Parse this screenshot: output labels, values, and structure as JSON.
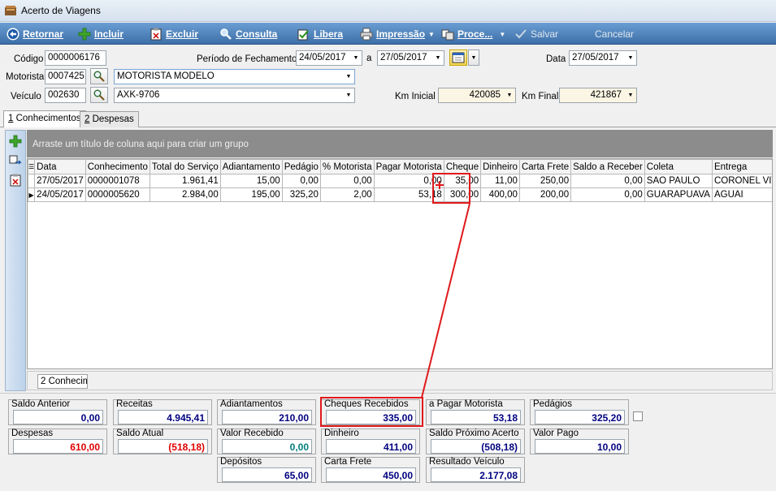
{
  "window": {
    "title": "Acerto de Viagens"
  },
  "toolbar": {
    "retornar": "Retornar",
    "incluir": "Incluir",
    "excluir": "Excluir",
    "consulta": "Consulta",
    "libera": "Libera",
    "impressao": "Impressão",
    "processo": "Proce...",
    "salvar": "Salvar",
    "cancelar": "Cancelar"
  },
  "form": {
    "codigo_label": "Código",
    "codigo_value": "0000006176",
    "periodo_label": "Período de Fechamento",
    "periodo_inicio": "24/05/2017",
    "periodo_a": "a",
    "periodo_fim": "27/05/2017",
    "data_label": "Data",
    "data_value": "27/05/2017",
    "motorista_label": "Motorista",
    "motorista_code": "0007425",
    "motorista_name": "MOTORISTA MODELO",
    "veiculo_label": "Veículo",
    "veiculo_code": "002630",
    "veiculo_placa": "AXK-9706",
    "km_inicial_label": "Km Inicial",
    "km_inicial_value": "420085",
    "km_final_label": "Km Final",
    "km_final_value": "421867"
  },
  "tabs": [
    {
      "key": "1",
      "rest": " Conhecimentos"
    },
    {
      "key": "2",
      "rest": " Despesas"
    }
  ],
  "grid": {
    "group_hint": "Arraste um título de coluna aqui para criar um grupo",
    "columns": [
      "Data",
      "Conhecimento",
      "Total do Serviço",
      "Adiantamento",
      "Pedágio",
      "% Motorista",
      "Pagar Motorista",
      "Cheque",
      "Dinheiro",
      "Carta Frete",
      "Saldo a Receber",
      "Coleta",
      "Entrega"
    ],
    "rows": [
      [
        "27/05/2017",
        "0000001078",
        "1.961,41",
        "15,00",
        "0,00",
        "0,00",
        "0,00",
        "35,00",
        "11,00",
        "250,00",
        "0,00",
        "SAO PAULO",
        "CORONEL VIVIDA"
      ],
      [
        "24/05/2017",
        "0000005620",
        "2.984,00",
        "195,00",
        "325,20",
        "2,00",
        "53,18",
        "300,00",
        "400,00",
        "200,00",
        "0,00",
        "GUARAPUAVA",
        "AGUAI"
      ]
    ],
    "footer_count": "2 Conhecim"
  },
  "summary": {
    "saldo_anterior": {
      "label": "Saldo Anterior",
      "value": "0,00"
    },
    "receitas": {
      "label": "Receitas",
      "value": "4.945,41"
    },
    "adiantamentos": {
      "label": "Adiantamentos",
      "value": "210,00"
    },
    "cheques_recebidos": {
      "label": "Cheques Recebidos",
      "value": "335,00"
    },
    "a_pagar_motorista": {
      "label": "a Pagar Motorista",
      "value": "53,18"
    },
    "pedagios": {
      "label": "Pedágios",
      "value": "325,20"
    },
    "despesas": {
      "label": "Despesas",
      "value": "610,00"
    },
    "saldo_atual": {
      "label": "Saldo Atual",
      "value": "(518,18)"
    },
    "valor_recebido": {
      "label": "Valor Recebido",
      "value": "0,00"
    },
    "dinheiro": {
      "label": "Dinheiro",
      "value": "411,00"
    },
    "saldo_proximo_acerto": {
      "label": "Saldo Próximo Acerto",
      "value": "(508,18)"
    },
    "valor_pago": {
      "label": "Valor Pago",
      "value": "10,00"
    },
    "depositos": {
      "label": "Depósitos",
      "value": "65,00"
    },
    "carta_frete": {
      "label": "Carta Frete",
      "value": "450,00"
    },
    "resultado_veiculo": {
      "label": "Resultado Veículo",
      "value": "2.177,08"
    }
  },
  "colors": {
    "value_blue": "#000080",
    "value_red": "#e00000",
    "value_teal": "#008080",
    "highlight": "#e0191c",
    "toolbar_bg": "#3d6fa8"
  }
}
